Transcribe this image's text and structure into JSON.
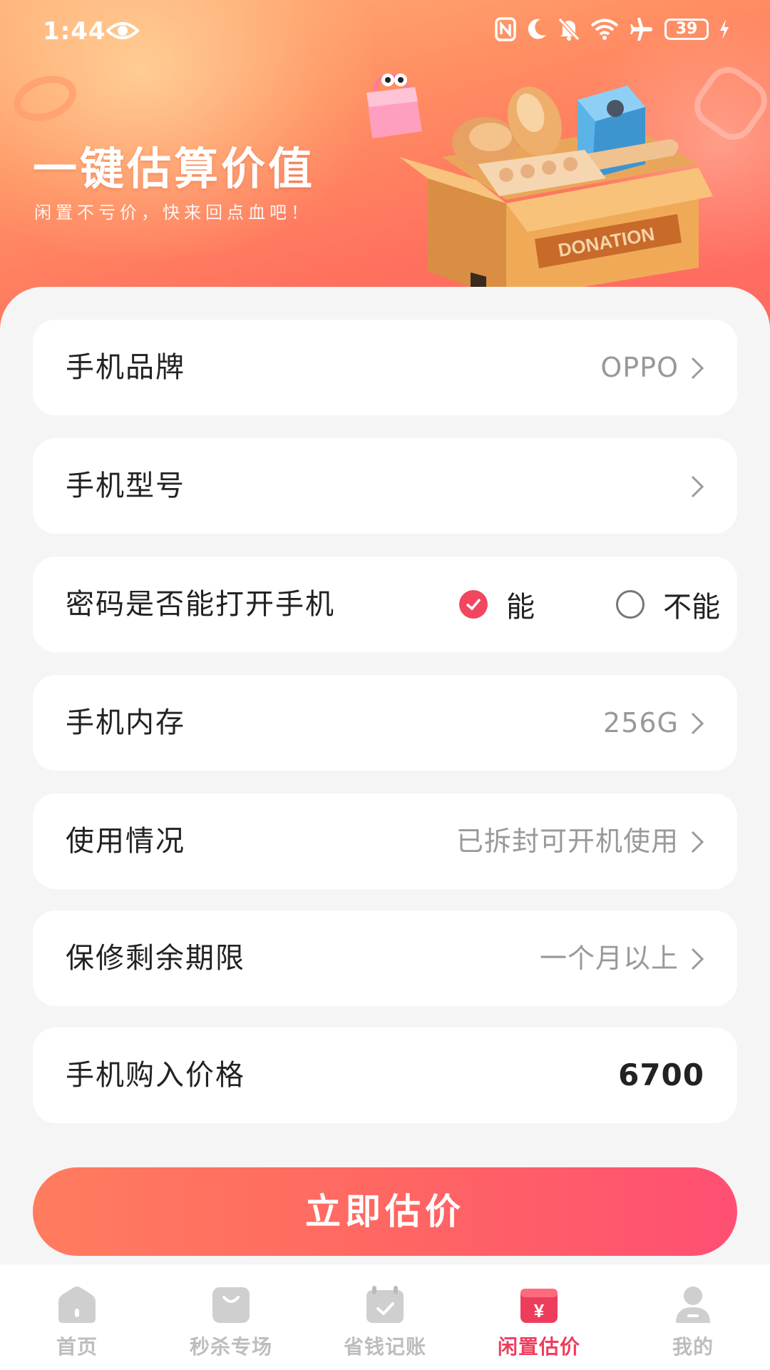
{
  "status_bar": {
    "time": "1:44",
    "battery": "39"
  },
  "hero": {
    "title": "一键估算价值",
    "subtitle": "闲置不亏价，快来回点血吧！",
    "box_label": "DONATION"
  },
  "form": {
    "brand": {
      "label": "手机品牌",
      "value": "OPPO"
    },
    "model": {
      "label": "手机型号",
      "value": ""
    },
    "password": {
      "label": "密码是否能打开手机",
      "options": [
        "能",
        "不能"
      ],
      "selected": "能"
    },
    "storage": {
      "label": "手机内存",
      "value": "256G"
    },
    "condition": {
      "label": "使用情况",
      "value": "已拆封可开机使用"
    },
    "warranty": {
      "label": "保修剩余期限",
      "value": "一个月以上"
    },
    "price": {
      "label": "手机购入价格",
      "value": "6700"
    }
  },
  "cta_label": "立即估价",
  "tabbar": {
    "items": [
      {
        "label": "首页",
        "icon": "home-icon"
      },
      {
        "label": "秒杀专场",
        "icon": "shopping-bag-icon"
      },
      {
        "label": "省钱记账",
        "icon": "calendar-check-icon"
      },
      {
        "label": "闲置估价",
        "icon": "yuan-box-icon"
      },
      {
        "label": "我的",
        "icon": "user-icon"
      }
    ],
    "active": "闲置估价"
  },
  "colors": {
    "accent": "#f0465e",
    "active_tab": "#ee3d5c",
    "hero_gradient_start": "#ffb27a",
    "hero_gradient_end": "#ff6a62"
  }
}
